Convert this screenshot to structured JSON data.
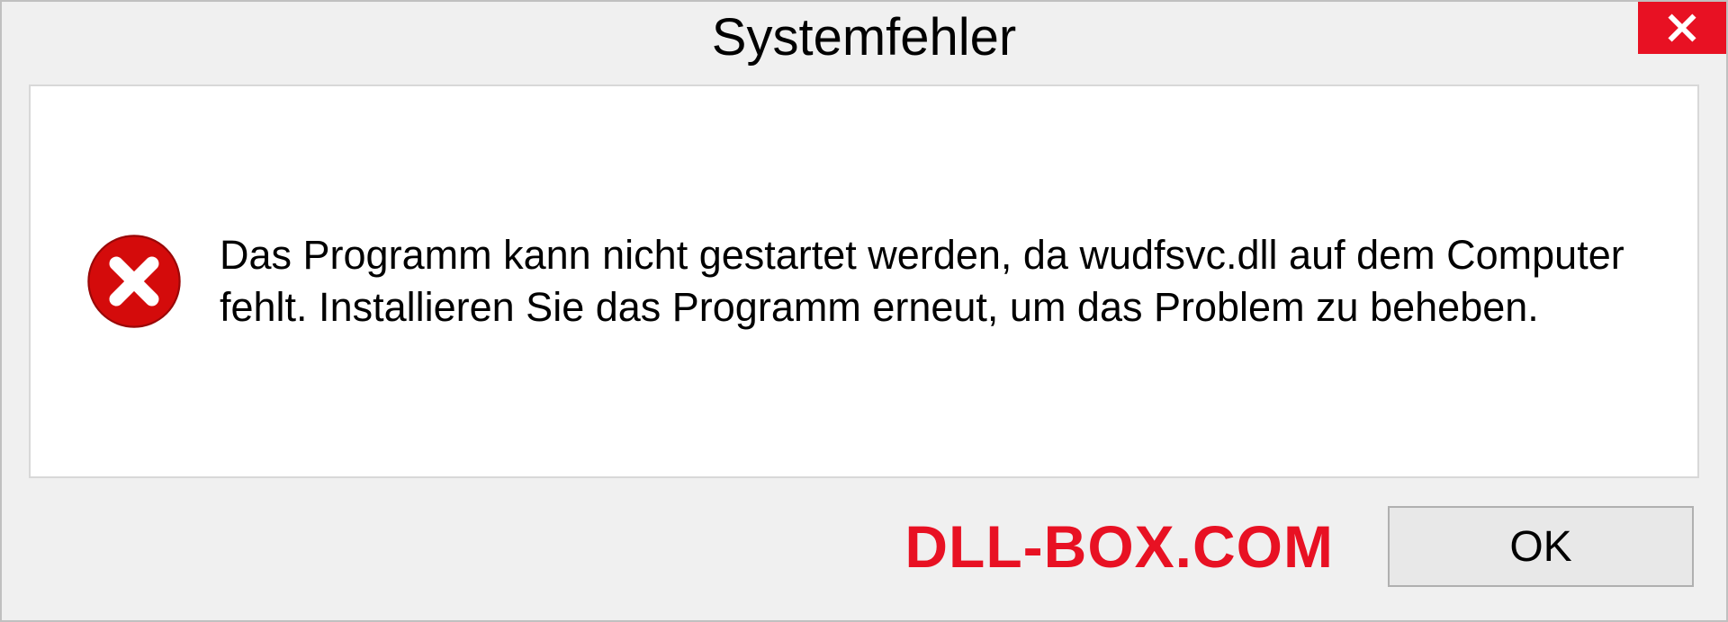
{
  "dialog": {
    "title": "Systemfehler",
    "message": "Das Programm kann nicht gestartet werden, da wudfsvc.dll auf dem Computer fehlt. Installieren Sie das Programm erneut, um das Problem zu beheben.",
    "ok_label": "OK"
  },
  "watermark": "DLL-BOX.COM",
  "colors": {
    "close_red": "#e81123",
    "error_red": "#d40b0b"
  }
}
